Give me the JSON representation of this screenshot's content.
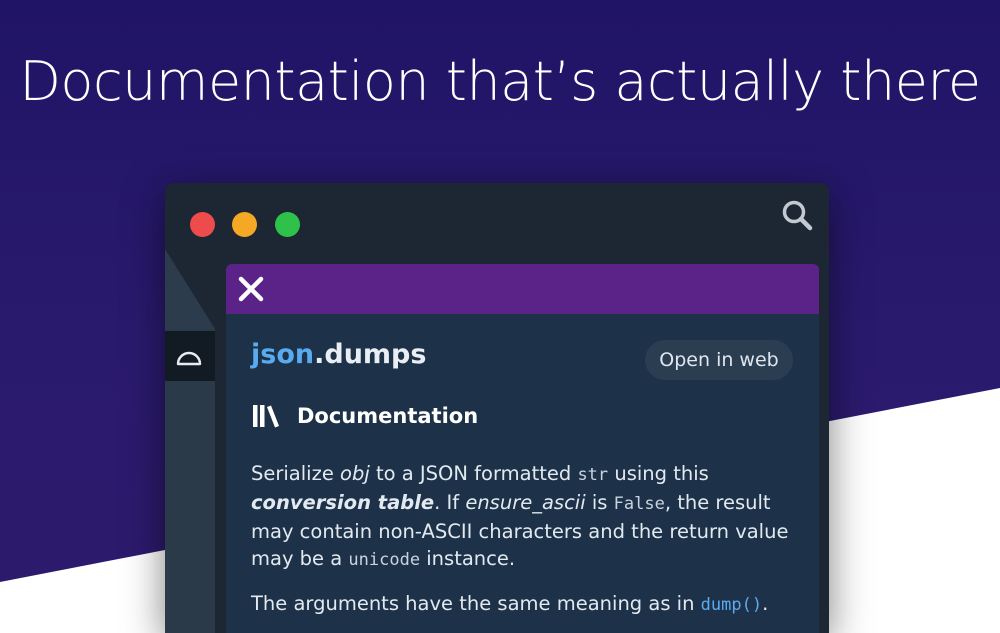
{
  "headline": "Documentation that’s actually there",
  "colors": {
    "background_purple": "#201466",
    "window_bg": "#1c2733",
    "panel_bg": "#1d3249",
    "panel_header": "#5b2288",
    "link_blue": "#5aaaf0"
  },
  "window": {
    "controls": {
      "close": "red",
      "minimize": "yellow",
      "zoom": "green"
    },
    "search_icon": "search-icon",
    "sidebar_icon": "half-circle-icon"
  },
  "doc_panel": {
    "close_icon": "close-icon",
    "symbol": {
      "module": "json",
      "separator": ".",
      "name": "dumps"
    },
    "open_in_web_label": "Open in web",
    "section": {
      "icon": "books-icon",
      "label": "Documentation"
    },
    "paragraph1": {
      "t1": "Serialize ",
      "obj": "obj",
      "t2": " to a JSON formatted ",
      "str": "str",
      "t3": " using this ",
      "conversion_table": "conversion table",
      "t4": ". If ",
      "ensure_ascii": "ensure_ascii",
      "t5": " is ",
      "false": "False",
      "t6": ", the result may contain non-ASCII characters and the return value may be a ",
      "unicode": "unicode",
      "t7": " instance."
    },
    "paragraph2": {
      "t1": "The arguments have the same meaning as in ",
      "dump": "dump()",
      "t2": "."
    }
  }
}
